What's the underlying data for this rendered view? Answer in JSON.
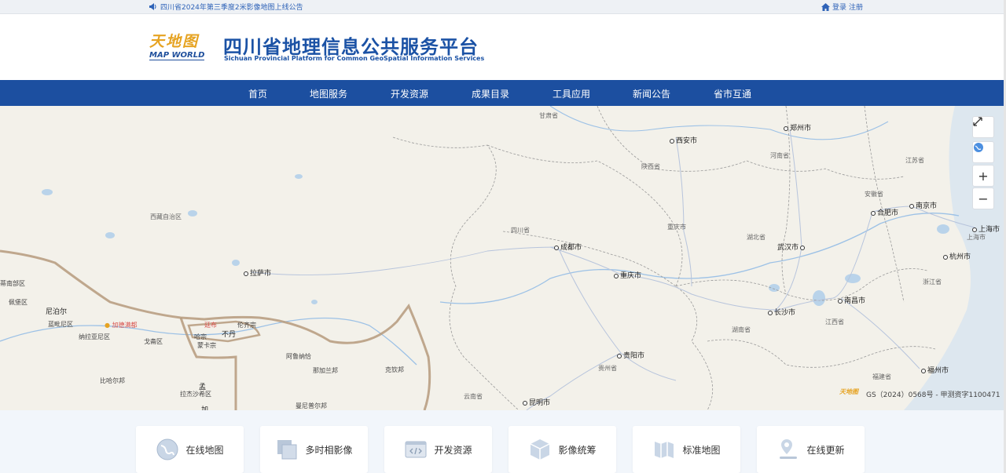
{
  "topbar": {
    "notice": "四川省2024年第三季度2米影像地图上线公告",
    "login": "登录",
    "register": "注册"
  },
  "header": {
    "logo_cn": "天地图",
    "logo_en": "MAP WORLD",
    "title": "四川省地理信息公共服务平台",
    "subtitle": "Sichuan Provincial Platform for Common GeoSpatial Information Services"
  },
  "nav": {
    "items": [
      "首页",
      "地图服务",
      "开发资源",
      "成果目录",
      "工具应用",
      "新闻公告",
      "省市互通"
    ]
  },
  "map": {
    "cities": [
      "西安市",
      "郑州市",
      "合肥市",
      "南京市",
      "上海市",
      "杭州市",
      "武汉市",
      "成都市",
      "重庆市",
      "拉萨市",
      "长沙市",
      "南昌市",
      "贵阳市",
      "福州市",
      "昆明市"
    ],
    "provinces": [
      "甘肃省",
      "陕西省",
      "河南省",
      "江苏省",
      "安徽省",
      "西藏自治区",
      "四川省",
      "重庆市",
      "湖北省",
      "上海市",
      "浙江省",
      "湖南省",
      "江西省",
      "贵州省",
      "福建省",
      "云南省"
    ],
    "foreign": [
      "尼泊尔",
      "不丹",
      "孟",
      "加"
    ],
    "foreign_regions": [
      "蒂南部区",
      "佩堡区",
      "蓝毗尼区",
      "纳拉亚尼区",
      "戈斋区",
      "哈宗",
      "蒙卡宗",
      "伦齐宗",
      "阿鲁纳恰",
      "那加兰邦",
      "克钦邦",
      "比哈尔邦",
      "拉杰沙希区",
      "曼尼普尔邦"
    ],
    "red_labels": [
      "加德满都",
      "廷布"
    ],
    "controls": {
      "fullscreen": "fullscreen-icon",
      "globe": "globe-icon",
      "zoom_in": "+",
      "zoom_out": "−"
    },
    "copyright": "GS（2024）0568号 - 甲测资字1100471",
    "watermark_logo": "天地图"
  },
  "tiles": [
    {
      "label": "在线地图",
      "icon": "globe-icon"
    },
    {
      "label": "多时相影像",
      "icon": "layers-icon"
    },
    {
      "label": "开发资源",
      "icon": "code-icon"
    },
    {
      "label": "影像统筹",
      "icon": "cube-icon"
    },
    {
      "label": "标准地图",
      "icon": "map-book-icon"
    },
    {
      "label": "在线更新",
      "icon": "location-pin-icon"
    }
  ],
  "colors": {
    "nav_bg": "#1c4fa0",
    "title": "#1b52a5",
    "logo_gold": "#e6a322",
    "map_bg": "#f3f1ea"
  }
}
